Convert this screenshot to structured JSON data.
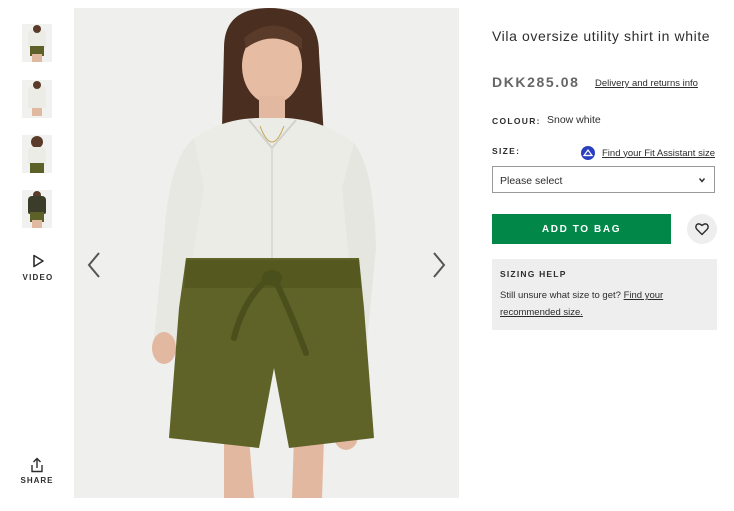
{
  "gallery": {
    "thumbnails": [
      {
        "alt": "thumbnail-1"
      },
      {
        "alt": "thumbnail-2"
      },
      {
        "alt": "thumbnail-3"
      },
      {
        "alt": "thumbnail-4"
      }
    ],
    "video_label": "VIDEO",
    "share_label": "SHARE",
    "icons": {
      "video": "play-icon",
      "share": "share-icon",
      "prev": "chevron-left-icon",
      "next": "chevron-right-icon"
    }
  },
  "product": {
    "title": "Vila oversize utility shirt in white",
    "price": "DKK285.08",
    "delivery_link": "Delivery and returns info",
    "colour_label": "COLOUR:",
    "colour_value": "Snow white",
    "size_label": "SIZE:",
    "fit_assistant_link": "Find your Fit Assistant size",
    "size_select": "Please select",
    "add_to_bag": "ADD TO BAG",
    "colors": {
      "accent": "#018849",
      "fit_icon": "#2a3fbf"
    }
  },
  "sizing_help": {
    "title": "SIZING HELP",
    "text": "Still unsure what size to get? ",
    "link": "Find your recommended size."
  }
}
